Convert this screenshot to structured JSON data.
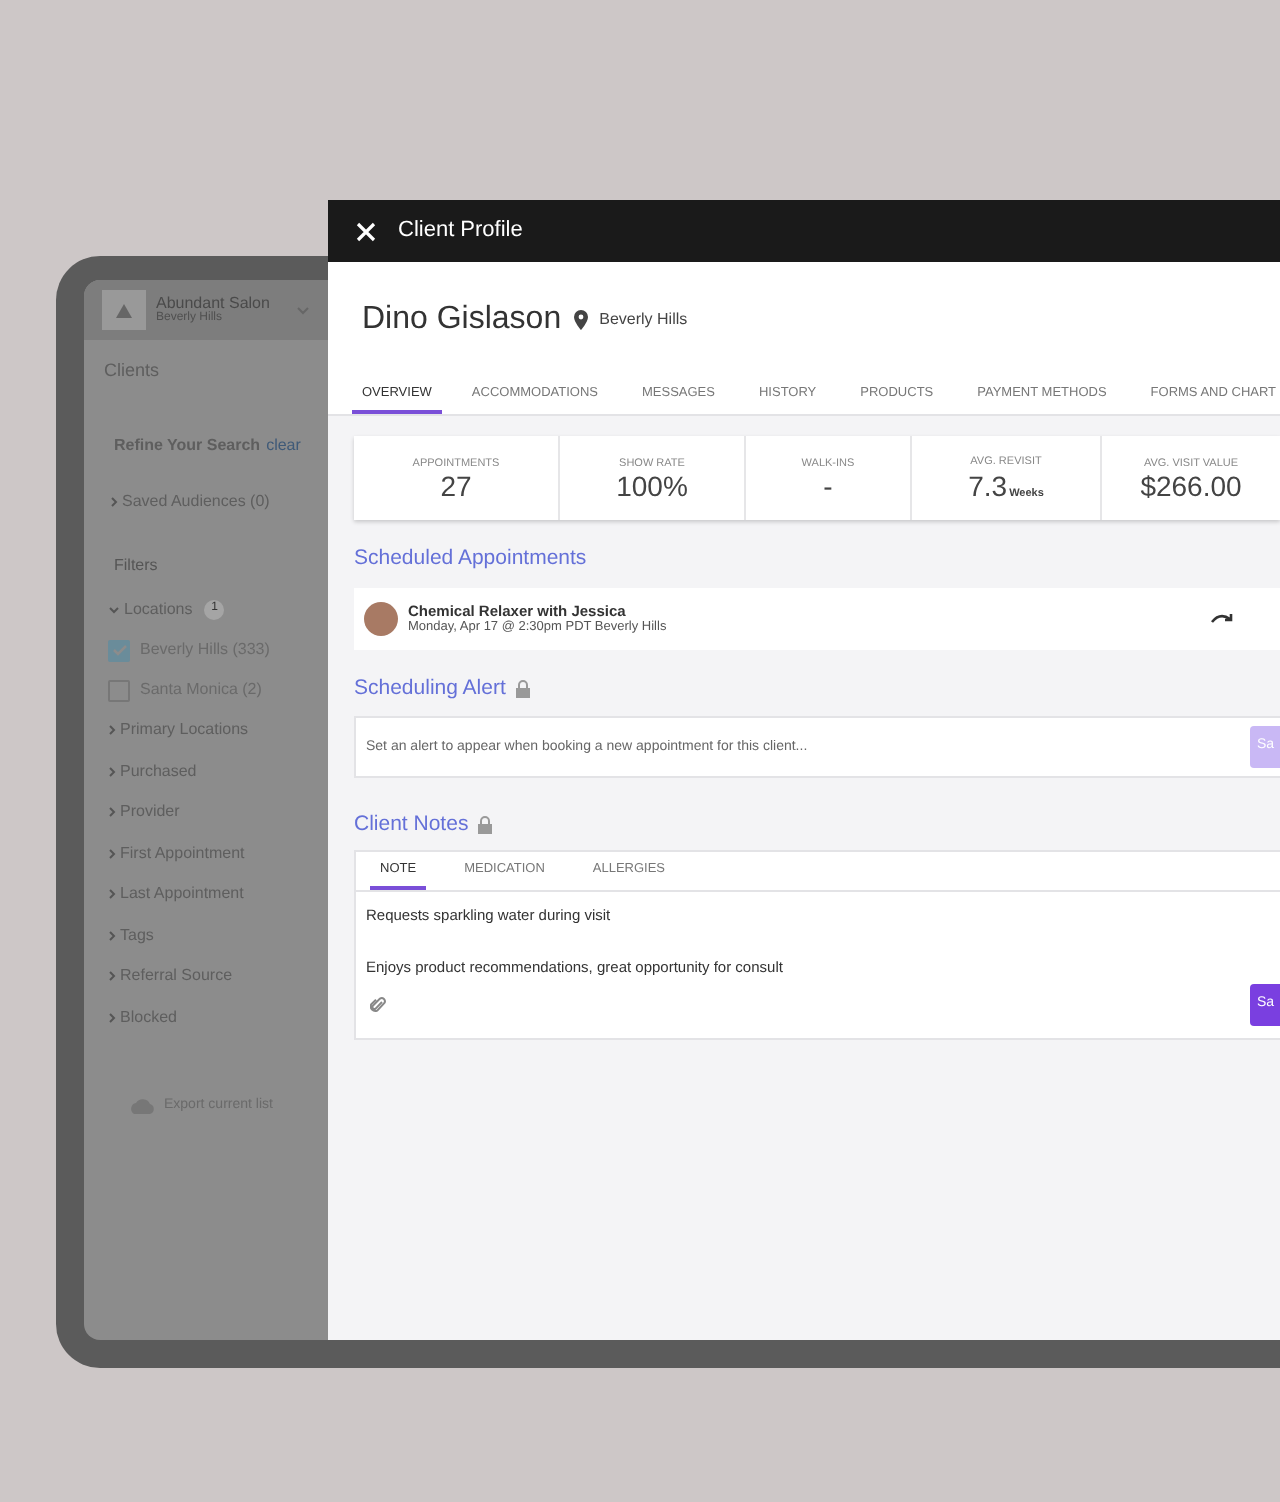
{
  "sidebar": {
    "salon_name": "Abundant Salon",
    "salon_location": "Beverly Hills",
    "title": "Clients",
    "refine_label": "Refine Your Search",
    "clear_link": "clear",
    "saved_audiences": "Saved Audiences (0)",
    "filters_label": "Filters",
    "filters": [
      {
        "label": "Locations",
        "expanded": true,
        "badge": "1",
        "children": [
          {
            "label": "Beverly Hills (333)",
            "checked": true
          },
          {
            "label": "Santa Monica (2)",
            "checked": false
          }
        ]
      },
      {
        "label": "Primary Locations",
        "expanded": false
      },
      {
        "label": "Purchased",
        "expanded": false
      },
      {
        "label": "Provider",
        "expanded": false
      },
      {
        "label": "First Appointment",
        "expanded": false
      },
      {
        "label": "Last Appointment",
        "expanded": false
      },
      {
        "label": "Tags",
        "expanded": false
      },
      {
        "label": "Referral Source",
        "expanded": false
      },
      {
        "label": "Blocked",
        "expanded": false
      }
    ],
    "export": "Export current list"
  },
  "panel": {
    "title": "Client Profile",
    "client_name": "Dino Gislason",
    "client_location": "Beverly Hills",
    "tabs": [
      {
        "label": "OVERVIEW",
        "selected": true
      },
      {
        "label": "ACCOMMODATIONS",
        "selected": false
      },
      {
        "label": "MESSAGES",
        "selected": false
      },
      {
        "label": "HISTORY",
        "selected": false
      },
      {
        "label": "PRODUCTS",
        "selected": false
      },
      {
        "label": "PAYMENT METHODS",
        "selected": false
      },
      {
        "label": "FORMS AND CHART",
        "selected": false
      }
    ],
    "stats": [
      {
        "label": "APPOINTMENTS",
        "value": "27"
      },
      {
        "label": "SHOW RATE",
        "value": "100%"
      },
      {
        "label": "WALK-INS",
        "value": "-"
      },
      {
        "label": "AVG. REVISIT",
        "value": "7.3",
        "unit": "Weeks"
      },
      {
        "label": "AVG. VISIT VALUE",
        "value": "$266.00"
      }
    ],
    "appointments_heading": "Scheduled Appointments",
    "appointment": {
      "title": "Chemical Relaxer with Jessica",
      "details": "Monday, Apr 17 @ 2:30pm PDT Beverly Hills"
    },
    "alert_heading": "Scheduling Alert",
    "alert_field": {
      "placeholder": "Set an alert to appear when booking a new appointment for this client..."
    },
    "alert_button": {
      "label": "Sa",
      "disabled": true
    },
    "notes_heading": "Client Notes",
    "note_tabs": [
      {
        "label": "NOTE",
        "selected": true
      },
      {
        "label": "MEDICATION",
        "selected": false
      },
      {
        "label": "ALLERGIES",
        "selected": false
      }
    ],
    "notes": [
      "Requests sparkling water during visit",
      "Enjoys product recommendations, great opportunity for consult"
    ],
    "notes_button": {
      "label": "Sa",
      "disabled": false
    }
  }
}
